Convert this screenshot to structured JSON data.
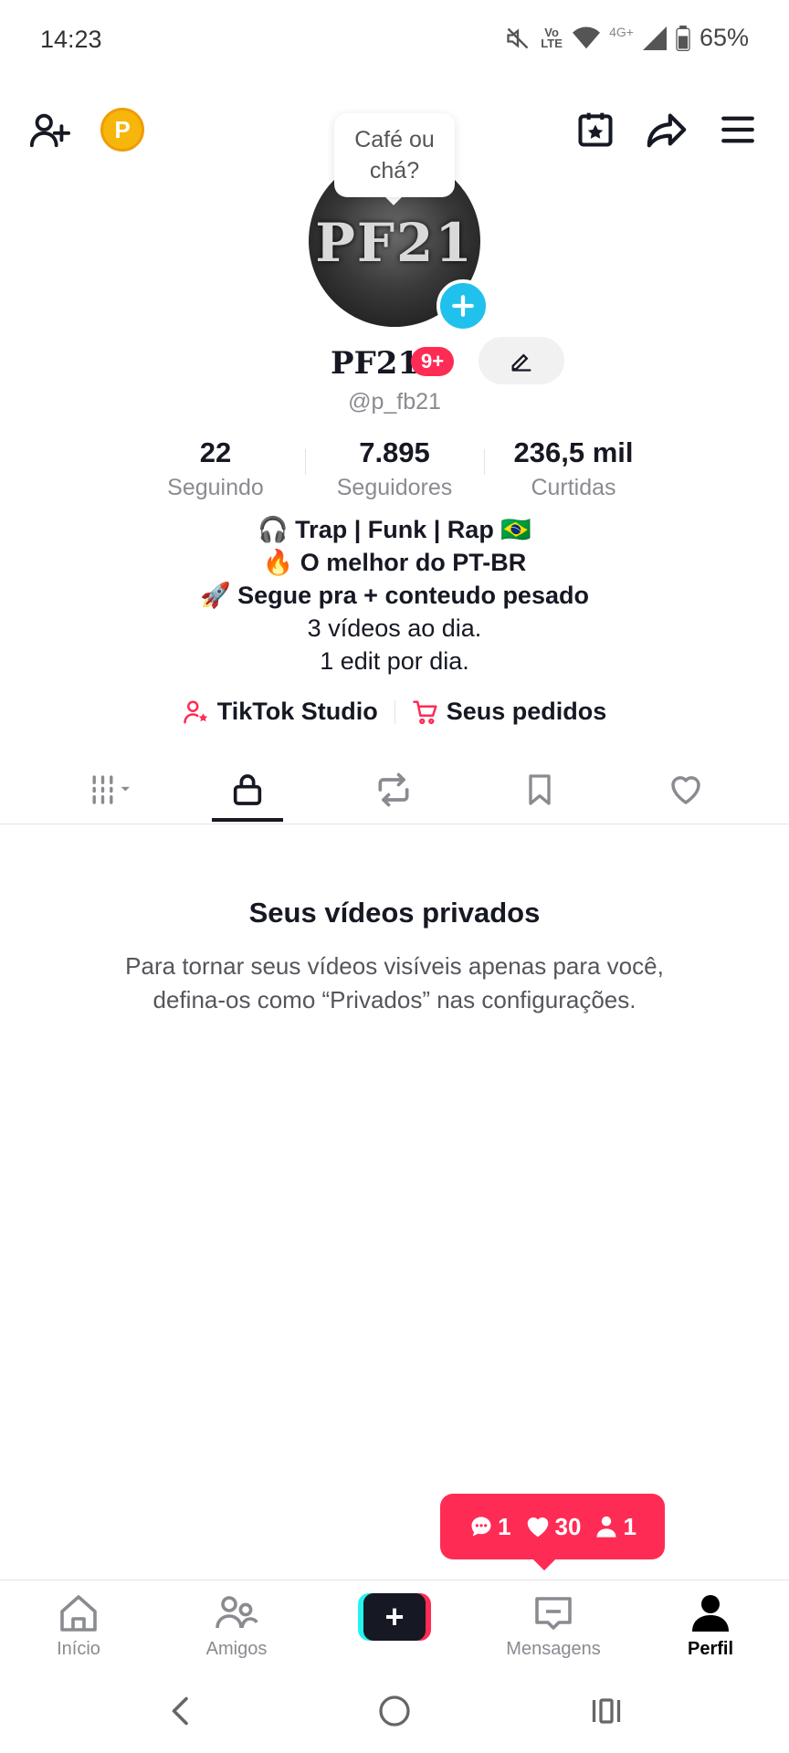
{
  "status_bar": {
    "time": "14:23",
    "network": "4G+",
    "volte": "Vo LTE",
    "battery": "65%"
  },
  "top_bar": {
    "coin_letter": "P",
    "icons": [
      "add-friend-icon",
      "coin-icon",
      "calendar-star-icon",
      "share-icon",
      "menu-icon"
    ]
  },
  "profile": {
    "bubble_text_1": "Café ou",
    "bubble_text_2": "chá?",
    "avatar_text": "PF21",
    "name": "PF21",
    "notification_badge": "9+",
    "handle": "@p_fb21"
  },
  "stats": [
    {
      "value": "22",
      "label": "Seguindo"
    },
    {
      "value": "7.895",
      "label": "Seguidores"
    },
    {
      "value": "236,5 mil",
      "label": "Curtidas"
    }
  ],
  "bio": {
    "line1": "🎧 Trap | Funk | Rap 🇧🇷",
    "line2": "🔥 O melhor do PT-BR",
    "line3": "🚀 Segue pra + conteudo pesado",
    "line4": "3 vídeos ao dia.",
    "line5": "1 edit por dia."
  },
  "links": {
    "studio": "TikTok Studio",
    "orders": "Seus pedidos"
  },
  "tabs": {
    "selected": "private",
    "items": [
      "videos-grid",
      "private",
      "reposts",
      "favorites",
      "liked"
    ]
  },
  "empty_state": {
    "title": "Seus vídeos privados",
    "line1": "Para tornar seus vídeos visíveis apenas para você,",
    "line2": "defina-os como “Privados” nas configurações."
  },
  "activity": {
    "comments": "1",
    "likes": "30",
    "followers": "1"
  },
  "bottom_nav": {
    "home": "Início",
    "friends": "Amigos",
    "messages": "Mensagens",
    "profile": "Perfil",
    "create": "+"
  },
  "colors": {
    "accent": "#fe2c55",
    "cyan": "#25f4ee",
    "avatar_add": "#20c1ec",
    "coin": "#f6b60c",
    "text": "#161823",
    "muted": "#8a8b91"
  }
}
